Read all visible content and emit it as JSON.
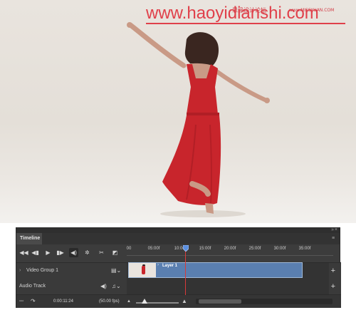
{
  "watermark": {
    "main": "www.haoyidianshi.com",
    "cn": "思缘设计论坛",
    "url": "www.MISSYUAN.COM"
  },
  "photo": {
    "subject": "woman-in-red-dress-dancing",
    "dress_color": "#c8252c",
    "background_color": "#e6e1db"
  },
  "timeline": {
    "tab_label": "Timeline",
    "controls": {
      "first_frame_icon": "skip-to-start-icon",
      "prev_frame_icon": "step-back-icon",
      "play_icon": "play-icon",
      "next_frame_icon": "step-forward-icon",
      "audio_icon": "speaker-icon",
      "settings_icon": "gear-icon",
      "split_icon": "scissors-icon",
      "transition_icon": "transition-icon"
    },
    "ruler": {
      "ticks": [
        "00",
        "05:00f",
        "10:00f",
        "15:00f",
        "20:00f",
        "25:00f",
        "30:00f",
        "35:00f"
      ]
    },
    "tracks": [
      {
        "name": "Video Group 1",
        "icon": "film-icon"
      },
      {
        "name": "Audio Track",
        "icon": "music-note-icon"
      }
    ],
    "clip": {
      "label": "Layer 1",
      "color": "#5a7fb0"
    },
    "playhead_color": "#d83a3a",
    "status": {
      "timecode": "0:00:11:24",
      "fps": "(50.00 fps)"
    }
  }
}
